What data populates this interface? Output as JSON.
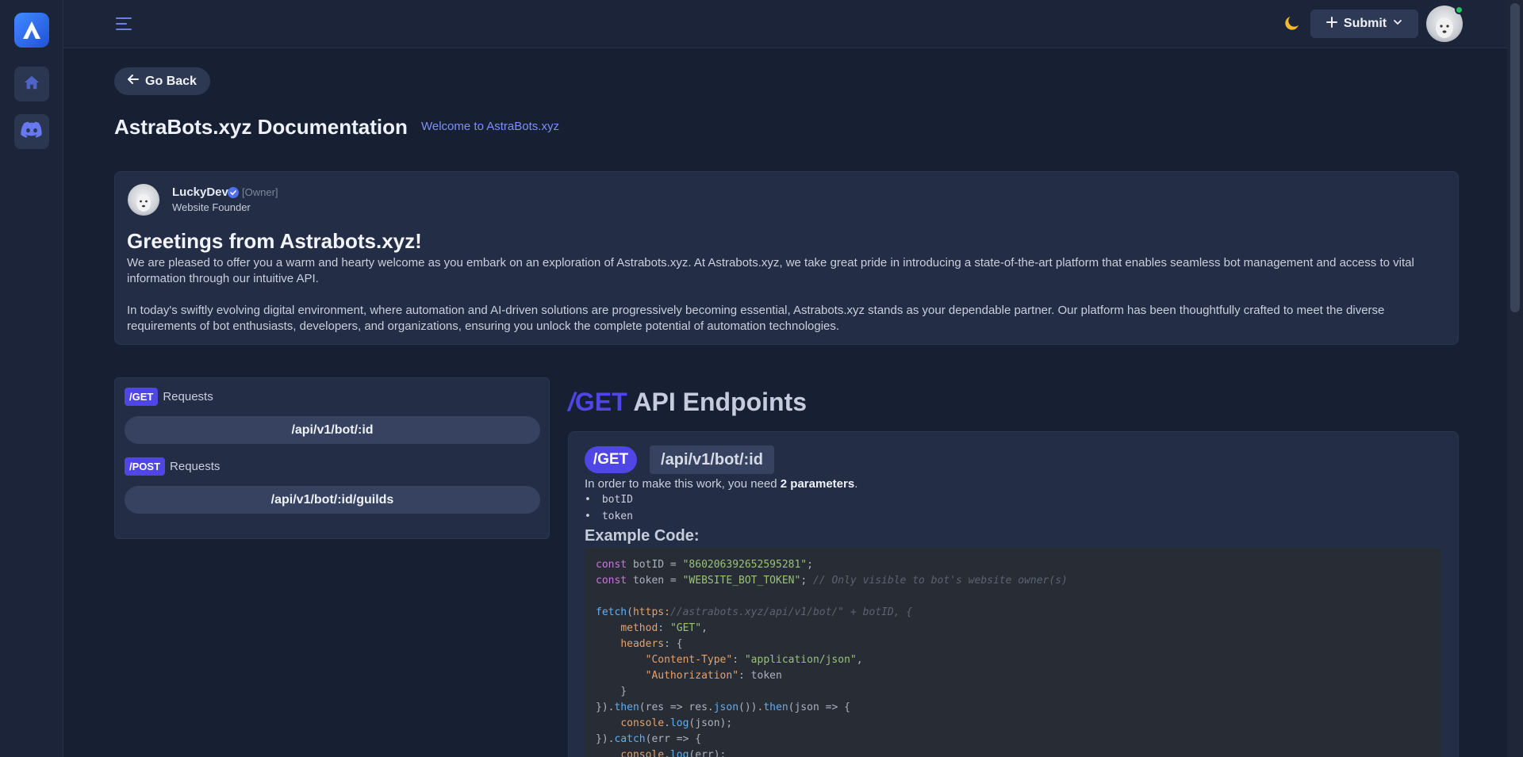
{
  "sidebar": {
    "items": [
      "home",
      "discord"
    ]
  },
  "header": {
    "submit_label": "Submit"
  },
  "page": {
    "go_back_label": "Go Back",
    "title": "AstraBots.xyz Documentation",
    "welcome_link": "Welcome to AstraBots.xyz"
  },
  "intro": {
    "author_name": "LuckyDev",
    "author_role": "[Owner]",
    "author_title": "Website Founder",
    "heading": "Greetings from Astrabots.xyz!",
    "paragraph1": "We are pleased to offer you a warm and hearty welcome as you embark on an exploration of Astrabots.xyz. At Astrabots.xyz, we take great pride in introducing a state-of-the-art platform that enables seamless bot management and access to vital information through our intuitive API.",
    "paragraph2": "In today's swiftly evolving digital environment, where automation and AI-driven solutions are progressively becoming essential, Astrabots.xyz stands as your dependable partner. Our platform has been thoughtfully crafted to meet the diverse requirements of bot enthusiasts, developers, and organizations, ensuring you unlock the complete potential of automation technologies."
  },
  "endpoints_nav": {
    "get_tag": "/GET",
    "get_label": "Requests",
    "get_items": [
      "/api/v1/bot/:id"
    ],
    "post_tag": "/POST",
    "post_label": "Requests",
    "post_items": [
      "/api/v1/bot/:id/guilds"
    ]
  },
  "api_section": {
    "heading_slash": "/",
    "heading_method": "GET",
    "heading_rest": " API Endpoints",
    "method_badge": "/GET",
    "path": "/api/v1/bot/:id",
    "need_prefix": "In order to make this work, you need ",
    "need_count": "2 parameters",
    "need_suffix": ".",
    "params": [
      "botID",
      "token"
    ],
    "example_title": "Example Code:"
  },
  "code": {
    "botid_value": "\"860206392652595281\"",
    "token_value": "\"WEBSITE_BOT_TOKEN\"",
    "token_comment": "// Only visible to bot's website owner(s)",
    "url_string": "//astrabots.xyz/api/v1/bot/\" + botID, {",
    "method_value": "\"GET\"",
    "content_type_key": "\"Content-Type\"",
    "content_type_value": "\"application/json\"",
    "authorization_key": "\"Authorization\""
  }
}
